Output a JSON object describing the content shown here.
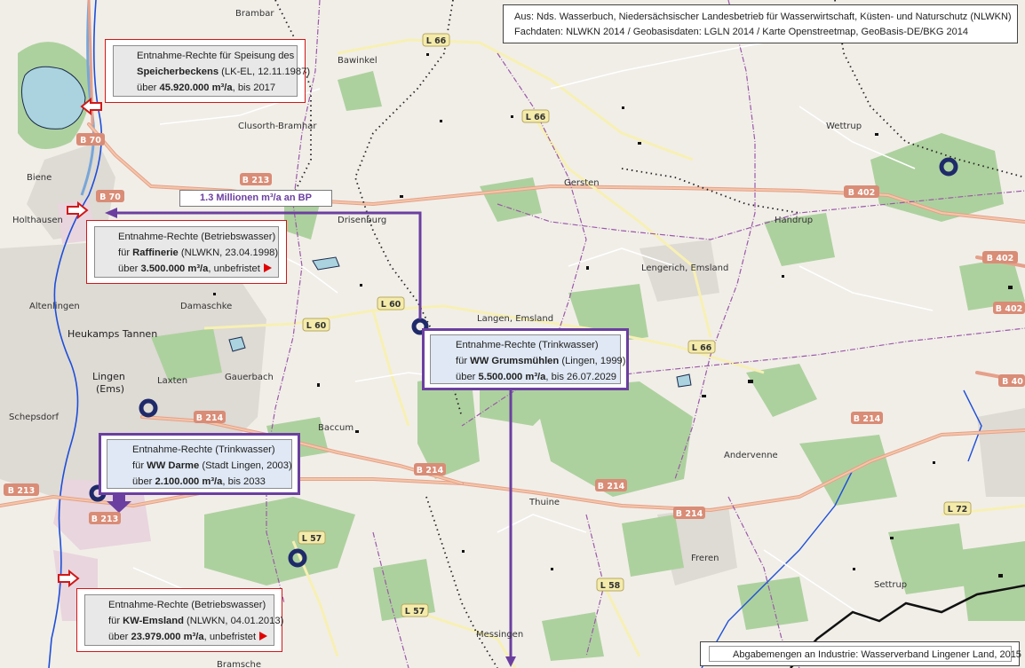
{
  "source": {
    "line1": "Aus: Nds. Wasserbuch, Niedersächsischer Landesbetrieb für Wasserwirtschaft, Küsten- und Naturschutz (NLWKN)",
    "line2": "Fachdaten: NLWKN 2014  /  Geobasisdaten: LGLN 2014  /  Karte Openstreetmap, GeoBasis-DE/BKG 2014"
  },
  "footer": {
    "text": "Abgabemengen an Industrie: Wasserverband Lingener Land, 2015"
  },
  "flow_label": {
    "text": "1.3 Millionen m³/a an BP"
  },
  "boxes": {
    "speicherbecken": {
      "l1": "Entnahme-Rechte für Speisung des",
      "l2_bold": "Speicherbeckens",
      "l2_rest": " (LK-EL, 12.11.1987)",
      "l3_pre": "über ",
      "l3_bold": "45.920.000 m³/a",
      "l3_rest": ", bis 2017"
    },
    "raffinerie": {
      "l1": "Entnahme-Rechte (Betriebswasser)",
      "l2_pre": "für ",
      "l2_bold": "Raffinerie",
      "l2_rest": " (NLWKN, 23.04.1998)",
      "l3_pre": "über ",
      "l3_bold": "3.500.000 m³/a",
      "l3_rest": ", unbefristet"
    },
    "grumsmuehlen": {
      "l1": "Entnahme-Rechte (Trinkwasser)",
      "l2_pre": "für ",
      "l2_bold": "WW Grumsmühlen",
      "l2_rest": " (Lingen, 1999)",
      "l3_pre": "über ",
      "l3_bold": "5.500.000 m³/a",
      "l3_rest": ", bis 26.07.2029"
    },
    "darme": {
      "l1": "Entnahme-Rechte (Trinkwasser)",
      "l2_pre": "für ",
      "l2_bold": "WW Darme",
      "l2_rest": " (Stadt Lingen, 2003)",
      "l3_pre": "über ",
      "l3_bold": "2.100.000 m³/a",
      "l3_rest": ", bis 2033"
    },
    "kw_emsland": {
      "l1": "Entnahme-Rechte (Betriebswasser)",
      "l2_pre": "für ",
      "l2_bold": "KW-Emsland",
      "l2_rest": " (NLWKN, 04.01.2013)",
      "l3_pre": "über ",
      "l3_bold": "23.979.000 m³/a",
      "l3_rest": ", unbefristet"
    }
  },
  "places": {
    "brambar": "Brambar",
    "bawinkel": "Bawinkel",
    "clusorth": "Clusorth-Bramhar",
    "wettrup": "Wettrup",
    "gersten": "Gersten",
    "biene": "Biene",
    "holthausen": "Holthausen",
    "drisenburg": "Drisenburg",
    "handrup": "Handrup",
    "lengerich": "Lengerich, Emsland",
    "altenlingen": "Altenlingen",
    "damaschke": "Damaschke",
    "heukamps": "Heukamps Tannen",
    "langen": "Langen, Emsland",
    "lingen": "Lingen (Ems)",
    "laxten": "Laxten",
    "gauerbach": "Gauerbach",
    "schepsdorf": "Schepsdorf",
    "baccum": "Baccum",
    "andervenne": "Andervenne",
    "thuine": "Thuine",
    "freren": "Freren",
    "messingen": "Messingen",
    "settrup": "Settrup",
    "bramsche": "Bramsche"
  },
  "roads": {
    "b70a": "B 70",
    "b70b": "B 70",
    "b213a": "B 213",
    "b213b": "B 213",
    "b213c": "B 213",
    "b214a": "B 214",
    "b214b": "B 214",
    "b214c": "B 214",
    "b214d": "B 214",
    "b402a": "B 402",
    "b402b": "B 402",
    "b402c": "B 402",
    "b40": "B 40",
    "l66a": "L 66",
    "l66b": "L 66",
    "l66c": "L 66",
    "l60a": "L 60",
    "l60b": "L 60",
    "l57a": "L 57",
    "l57b": "L 57",
    "l58": "L 58",
    "l72": "L 72"
  },
  "colors": {
    "flow_violet": "#6b3fa0",
    "right_red": "#d01818",
    "water": "#aad3df",
    "forest": "#add19e",
    "river_blue": "#1d4fd8",
    "well_navy": "#1f2a6a"
  }
}
